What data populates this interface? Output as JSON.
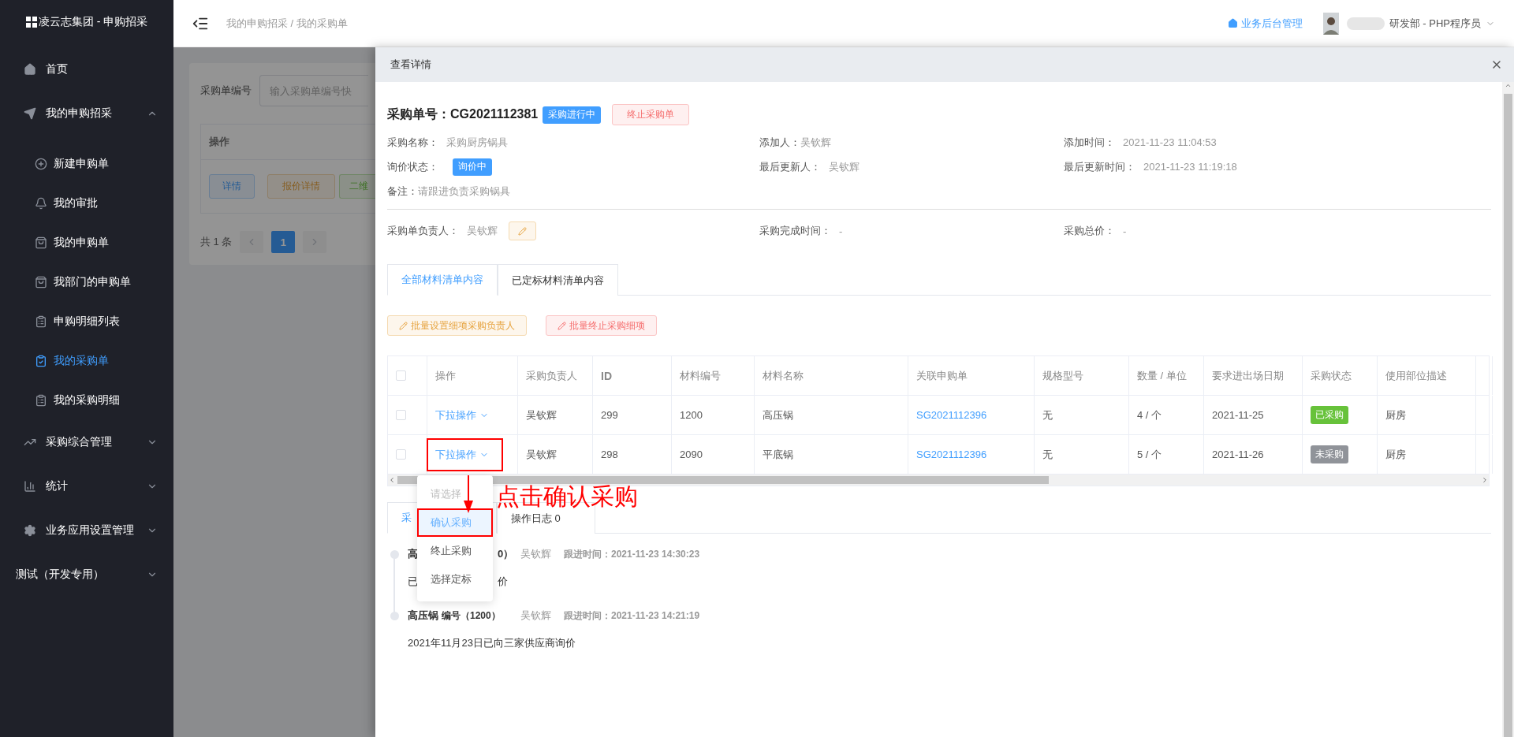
{
  "sidebar": {
    "logo": "凌云志集团 - 申购招采",
    "items": [
      {
        "label": "首页",
        "kind": "link"
      },
      {
        "label": "我的申购招采",
        "kind": "group",
        "expanded": true,
        "children": [
          {
            "label": "新建申购单",
            "selected": false
          },
          {
            "label": "我的审批",
            "selected": false
          },
          {
            "label": "我的申购单",
            "selected": false
          },
          {
            "label": "我部门的申购单",
            "selected": false
          },
          {
            "label": "申购明细列表",
            "selected": false
          },
          {
            "label": "我的采购单",
            "selected": true
          },
          {
            "label": "我的采购明细",
            "selected": false
          }
        ]
      },
      {
        "label": "采购综合管理",
        "kind": "group",
        "expanded": false
      },
      {
        "label": "统计",
        "kind": "group",
        "expanded": false
      },
      {
        "label": "业务应用设置管理",
        "kind": "group",
        "expanded": false
      },
      {
        "label": "测试（开发专用）",
        "kind": "group",
        "expanded": false
      }
    ]
  },
  "header": {
    "breadcrumb": "我的申购招采 / 我的采购单",
    "admin_link": "业务后台管理",
    "user_role": "研发部 - PHP程序员"
  },
  "background_page": {
    "search_label": "采购单编号",
    "search_placeholder": "输入采购单编号快",
    "table_header": "操作",
    "buttons": [
      {
        "label": "详情",
        "kind": "primary"
      },
      {
        "label": "报价详情",
        "kind": "warning"
      },
      {
        "label": "二维",
        "kind": "success"
      }
    ],
    "total": "共 1 条",
    "pages": [
      {
        "label": "1",
        "selected": true
      }
    ]
  },
  "drawer": {
    "title": "查看详情",
    "order": "采购单号：CG2021112381",
    "status_tag": "采购进行中",
    "stop_button": "终止采购单",
    "info": [
      {
        "label": "采购名称：",
        "value": "采购厨房锅具",
        "kind": "text"
      },
      {
        "label": "添加人：",
        "value": "吴钦辉",
        "kind": "text"
      },
      {
        "label": "添加时间：",
        "value": "2021-11-23 11:04:53",
        "kind": "text"
      },
      {
        "label": "询价状态：",
        "value": "询价中",
        "kind": "tag"
      },
      {
        "label": "最后更新人：",
        "value": "吴钦辉",
        "kind": "text"
      },
      {
        "label": "最后更新时间：",
        "value": "2021-11-23 11:19:18",
        "kind": "text"
      },
      {
        "label": "备注：",
        "value": "请跟进负责采购锅具",
        "kind": "text"
      }
    ],
    "summary": [
      {
        "label": "采购单负责人：",
        "value": "吴钦辉",
        "kind": "editable"
      },
      {
        "label": "采购完成时间：",
        "value": "-",
        "kind": "text"
      },
      {
        "label": "采购总价：",
        "value": "-",
        "kind": "text"
      }
    ],
    "tabs": [
      {
        "label": "全部材料清单内容",
        "selected": true
      },
      {
        "label": "已定标材料清单内容",
        "selected": false
      }
    ],
    "batch_buttons": [
      {
        "label": "批量设置细项采购负责人",
        "kind": "warning"
      },
      {
        "label": "批量终止采购细项",
        "kind": "danger"
      }
    ],
    "table": {
      "all_checked": false,
      "columns": [
        "操作",
        "采购负责人",
        "ID",
        "材料编号",
        "材料名称",
        "关联申购单",
        "规格型号",
        "数量 / 单位",
        "要求进出场日期",
        "采购状态",
        "使用部位描述"
      ],
      "rows": [
        {
          "checked": false,
          "action": "下拉操作",
          "highlighted": false,
          "owner": "吴钦辉",
          "id": "299",
          "code": "1200",
          "name": "高压锅",
          "request": "SG2021112396",
          "spec": "无",
          "qty": "4 / 个",
          "date": "2021-11-25",
          "status": {
            "label": "已采购",
            "color": "#67c23a"
          },
          "usage": "厨房"
        },
        {
          "checked": false,
          "action": "下拉操作",
          "highlighted": true,
          "owner": "吴钦辉",
          "id": "298",
          "code": "2090",
          "name": "平底锅",
          "request": "SG2021112396",
          "spec": "无",
          "qty": "5 / 个",
          "date": "2021-11-26",
          "status": {
            "label": "未采购",
            "color": "#909399"
          },
          "usage": "厨房"
        }
      ]
    },
    "dropdown": [
      {
        "label": "请选择",
        "disabled": true,
        "selected": false,
        "highlighted": false
      },
      {
        "label": "确认采购",
        "disabled": false,
        "selected": true,
        "highlighted": true
      },
      {
        "label": "终止采购",
        "disabled": false,
        "selected": false,
        "highlighted": false
      },
      {
        "label": "选择定标",
        "disabled": false,
        "selected": false,
        "highlighted": false
      }
    ],
    "annotation": "点击确认采购",
    "lower_tabs": [
      {
        "label": "采",
        "selected": true
      },
      {
        "label": "操作日志 0",
        "selected": false
      }
    ],
    "timeline": [
      {
        "kind": "partial",
        "title": "高",
        "title_tail": "0）",
        "person": "吴钦辉",
        "time": "跟进时间：2021-11-23 14:30:23",
        "text": "已",
        "text_tail": "价"
      },
      {
        "kind": "full",
        "title": "高压锅",
        "code": "编号（1200）",
        "person": "吴钦辉",
        "time": "跟进时间：2021-11-23 14:21:19",
        "text": "2021年11月23日已向三家供应商询价"
      }
    ]
  }
}
